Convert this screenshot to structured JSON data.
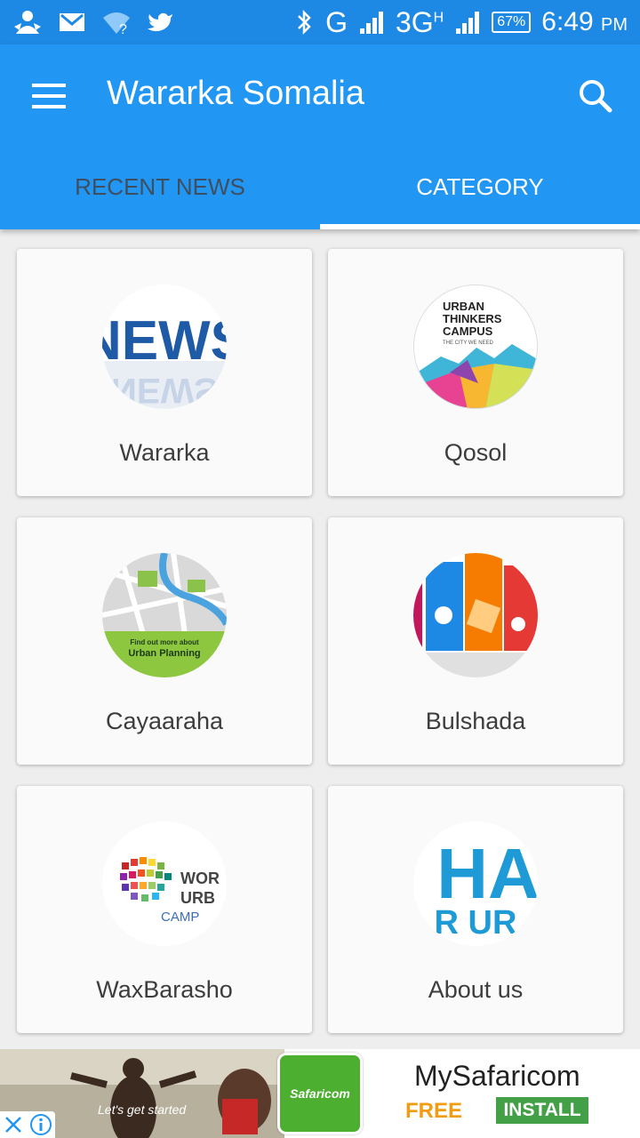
{
  "status_bar": {
    "network_g": "G",
    "network_3g": "3G",
    "network_h": "H",
    "battery": "67%",
    "time": "6:49",
    "ampm": "PM",
    "icons": [
      "person-icon",
      "gmail-icon",
      "wifi-question-icon",
      "twitter-icon",
      "bluetooth-icon",
      "signal-icon",
      "battery-icon"
    ]
  },
  "app_bar": {
    "title": "Wararka Somalia",
    "background": "#2196f3",
    "status_background": "#1e88e5"
  },
  "tabs": [
    {
      "label": "RECENT NEWS",
      "active": false
    },
    {
      "label": "CATEGORY",
      "active": true
    }
  ],
  "categories": [
    {
      "label": "Wararka",
      "thumb_text": "NEWS"
    },
    {
      "label": "Qosol",
      "thumb_text": [
        "URBAN",
        "THINKERS",
        "CAMPUS",
        "THE CITY WE NEED"
      ]
    },
    {
      "label": "Cayaaraha",
      "thumb_text": [
        "Find out more about",
        "Urban Planning"
      ]
    },
    {
      "label": "Bulshada",
      "thumb_text": ""
    },
    {
      "label": "WaxBarasho",
      "thumb_text": [
        "WOR",
        "URB",
        "CAMP"
      ]
    },
    {
      "label": "About us",
      "thumb_text": [
        "HA",
        "R UR"
      ]
    }
  ],
  "ad": {
    "tagline": "Let's get started",
    "brand": "Safaricom",
    "title": "MySafaricom",
    "price": "FREE",
    "cta": "INSTALL"
  }
}
